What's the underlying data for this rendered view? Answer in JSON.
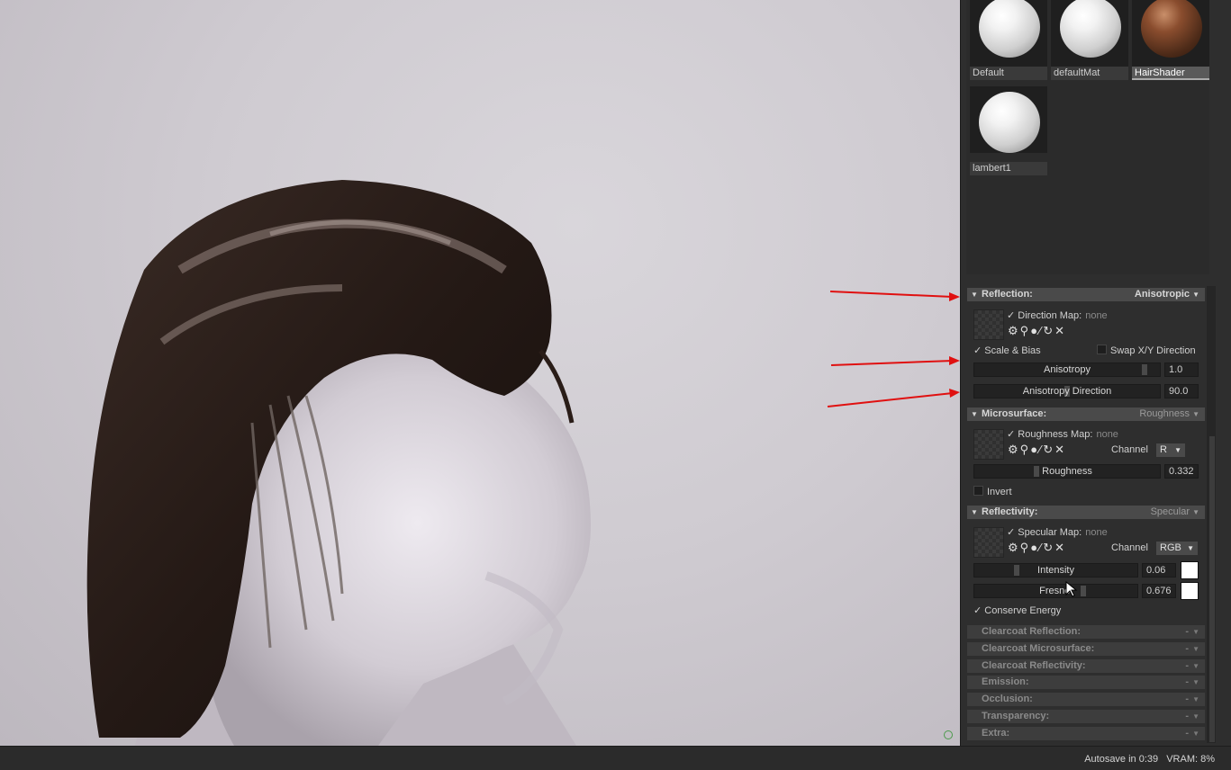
{
  "materials": [
    {
      "name": "Default",
      "selected": false
    },
    {
      "name": "defaultMat",
      "selected": false
    },
    {
      "name": "HairShader",
      "selected": true
    },
    {
      "name": "lambert1",
      "selected": false
    }
  ],
  "reflection": {
    "title": "Reflection:",
    "mode": "Anisotropic",
    "map_label": "Direction Map:",
    "map_value": "none",
    "scale_bias": "Scale & Bias",
    "swap_xy": "Swap X/Y Direction",
    "anisotropy_label": "Anisotropy",
    "anisotropy_value": "1.0",
    "anisotropy_fill": 0.93,
    "direction_label": "Anisotropy Direction",
    "direction_value": "90.0",
    "direction_fill": 0.5
  },
  "microsurface": {
    "title": "Microsurface:",
    "mode": "Roughness",
    "map_label": "Roughness Map:",
    "map_value": "none",
    "channel_label": "Channel",
    "channel_value": "R",
    "roughness_label": "Roughness",
    "roughness_value": "0.332",
    "roughness_fill": 0.332,
    "invert": "Invert"
  },
  "reflectivity": {
    "title": "Reflectivity:",
    "mode": "Specular",
    "map_label": "Specular Map:",
    "map_value": "none",
    "channel_label": "Channel",
    "channel_value": "RGB",
    "intensity_label": "Intensity",
    "intensity_value": "0.06",
    "intensity_fill": 0.25,
    "fresnel_label": "Fresnel",
    "fresnel_value": "0.676",
    "fresnel_fill": 0.676,
    "conserve": "Conserve Energy"
  },
  "collapsed_sections": [
    {
      "title": "Clearcoat Reflection:",
      "mode": "-"
    },
    {
      "title": "Clearcoat Microsurface:",
      "mode": "-"
    },
    {
      "title": "Clearcoat Reflectivity:",
      "mode": "-"
    },
    {
      "title": "Emission:",
      "mode": "-"
    },
    {
      "title": "Occlusion:",
      "mode": "-"
    },
    {
      "title": "Transparency:",
      "mode": "-"
    },
    {
      "title": "Extra:",
      "mode": "-"
    }
  ],
  "status": {
    "autosave": "Autosave in 0:39",
    "vram": "VRAM: 8%"
  },
  "colors": {
    "annotation_arrow": "#e01010"
  }
}
